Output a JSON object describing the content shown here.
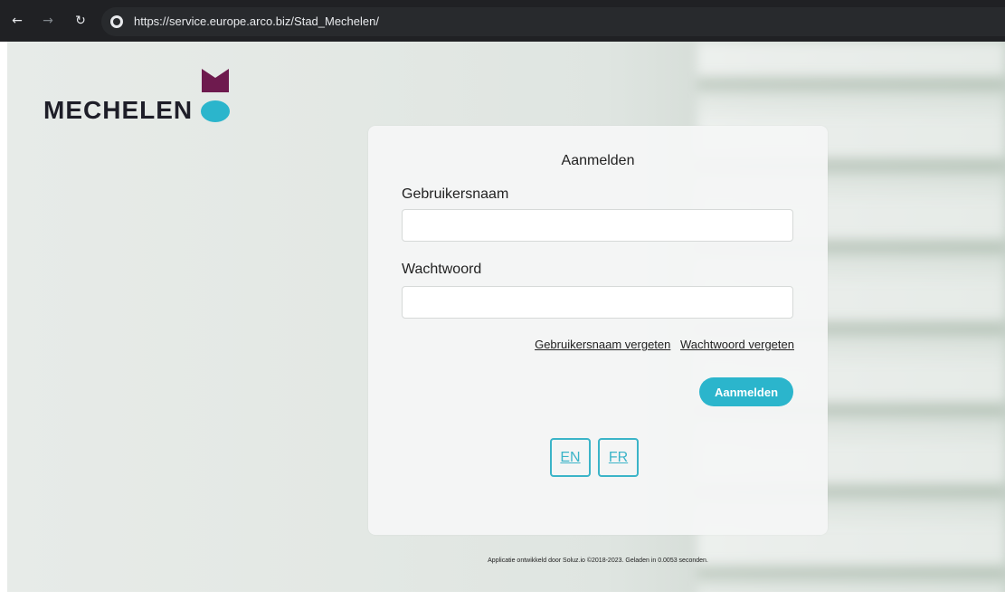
{
  "browser": {
    "url": "https://service.europe.arco.biz/Stad_Mechelen/",
    "back_icon": "arrow-left-icon",
    "forward_icon": "arrow-right-icon",
    "reload_icon": "reload-icon",
    "site_info_icon": "globe-icon"
  },
  "logo": {
    "text": "MECHELEN",
    "colors": {
      "mark_top": "#6e1a4e",
      "mark_bottom": "#2bb5cc",
      "text": "#1e1e28"
    }
  },
  "login": {
    "title": "Aanmelden",
    "username_label": "Gebruikersnaam",
    "username_value": "",
    "password_label": "Wachtwoord",
    "password_value": "",
    "forgot_username": "Gebruikersnaam vergeten",
    "forgot_password": "Wachtwoord vergeten",
    "submit_label": "Aanmelden",
    "languages": [
      "EN",
      "FR"
    ]
  },
  "colors": {
    "accent": "#2bb5cc"
  },
  "footer": "Applicatie ontwikkeld door Soluz.io ©2018-2023. Geladen in 0.0053 seconden."
}
